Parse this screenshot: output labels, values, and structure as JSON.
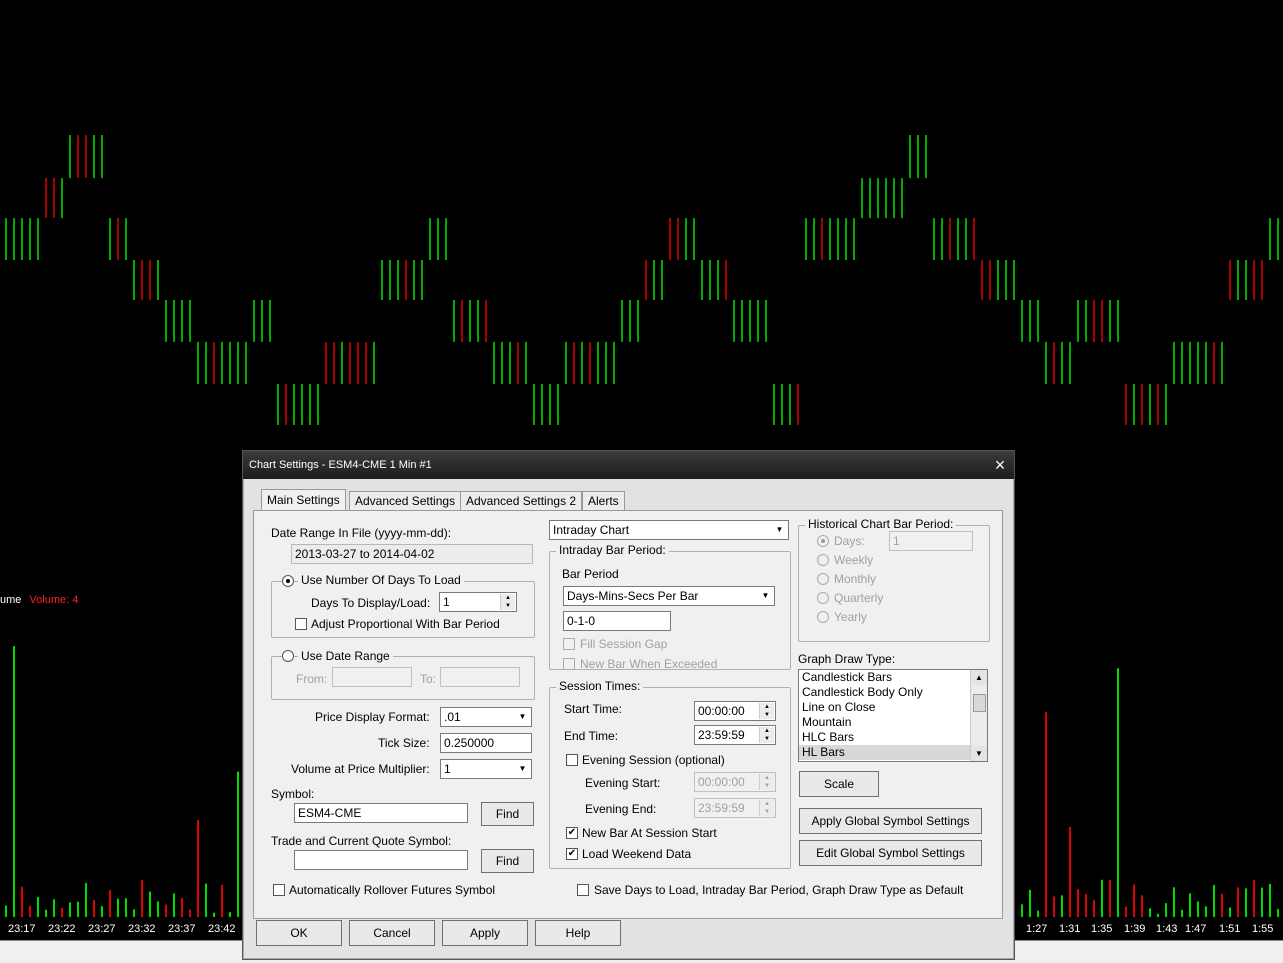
{
  "chart": {
    "volume_label": "ume",
    "volume_value": "Volume: 4",
    "time_ticks": [
      "23:17",
      "23:22",
      "23:27",
      "23:32",
      "23:37",
      "23:42",
      "1:27",
      "1:31",
      "1:35",
      "1:39",
      "1:43",
      "1:47",
      "1:51",
      "1:55"
    ],
    "colors": {
      "up": "#00e000",
      "down": "#e00000",
      "background": "#000000"
    }
  },
  "dialog": {
    "title": "Chart Settings - ESM4-CME  1 Min   #1",
    "close_icon": "×",
    "tabs": [
      "Main Settings",
      "Advanced Settings",
      "Advanced Settings 2",
      "Alerts"
    ],
    "active_tab": "Main Settings",
    "left": {
      "date_range_label": "Date Range In File (yyyy-mm-dd):",
      "date_range_value": "2013-03-27 to 2014-04-02",
      "use_days_label": "Use Number Of Days To Load",
      "days_label": "Days To Display/Load:",
      "days_value": "1",
      "adjust_label": "Adjust Proportional With Bar Period",
      "use_date_range_label": "Use Date Range",
      "from_label": "From:",
      "to_label": "To:",
      "price_format_label": "Price Display Format:",
      "price_format_value": ".01",
      "tick_size_label": "Tick Size:",
      "tick_size_value": "0.250000",
      "vol_mult_label": "Volume at Price Multiplier:",
      "vol_mult_value": "1",
      "symbol_label": "Symbol:",
      "symbol_value": "ESM4-CME",
      "find_label": "Find",
      "trade_symbol_label": "Trade and Current Quote Symbol:",
      "trade_symbol_value": "",
      "rollover_label": "Automatically Rollover Futures Symbol"
    },
    "middle": {
      "chart_type_value": "Intraday Chart",
      "intraday_period_caption": "Intraday Bar Period:",
      "bar_period_label": "Bar Period",
      "bar_period_type": "Days-Mins-Secs Per Bar",
      "bar_period_value": "0-1-0",
      "fill_gap_label": "Fill Session Gap",
      "new_bar_exceeded_label": "New Bar When Exceeded",
      "session_caption": "Session Times:",
      "start_label": "Start Time:",
      "start_value": "00:00:00",
      "end_label": "End Time:",
      "end_value": "23:59:59",
      "evening_label": "Evening Session (optional)",
      "evening_start_label": "Evening Start:",
      "evening_start_value": "00:00:00",
      "evening_end_label": "Evening End:",
      "evening_end_value": "23:59:59",
      "new_bar_session_label": "New Bar At Session Start",
      "weekend_label": "Load Weekend Data",
      "save_default_label": "Save Days to Load, Intraday Bar Period, Graph Draw Type as Default"
    },
    "right": {
      "hist_caption": "Historical Chart Bar Period:",
      "days_label": "Days:",
      "days_value": "1",
      "weekly_label": "Weekly",
      "monthly_label": "Monthly",
      "quarterly_label": "Quarterly",
      "yearly_label": "Yearly",
      "draw_type_label": "Graph Draw Type:",
      "draw_types": [
        "Candlestick Bars",
        "Candlestick Body Only",
        "Line on Close",
        "Mountain",
        "HLC Bars",
        "HL Bars"
      ],
      "selected_draw_type": "HL Bars",
      "scale_label": "Scale",
      "apply_global_label": "Apply Global Symbol Settings",
      "edit_global_label": "Edit Global Symbol Settings"
    },
    "footer": {
      "ok": "OK",
      "cancel": "Cancel",
      "apply": "Apply",
      "help": "Help"
    }
  }
}
